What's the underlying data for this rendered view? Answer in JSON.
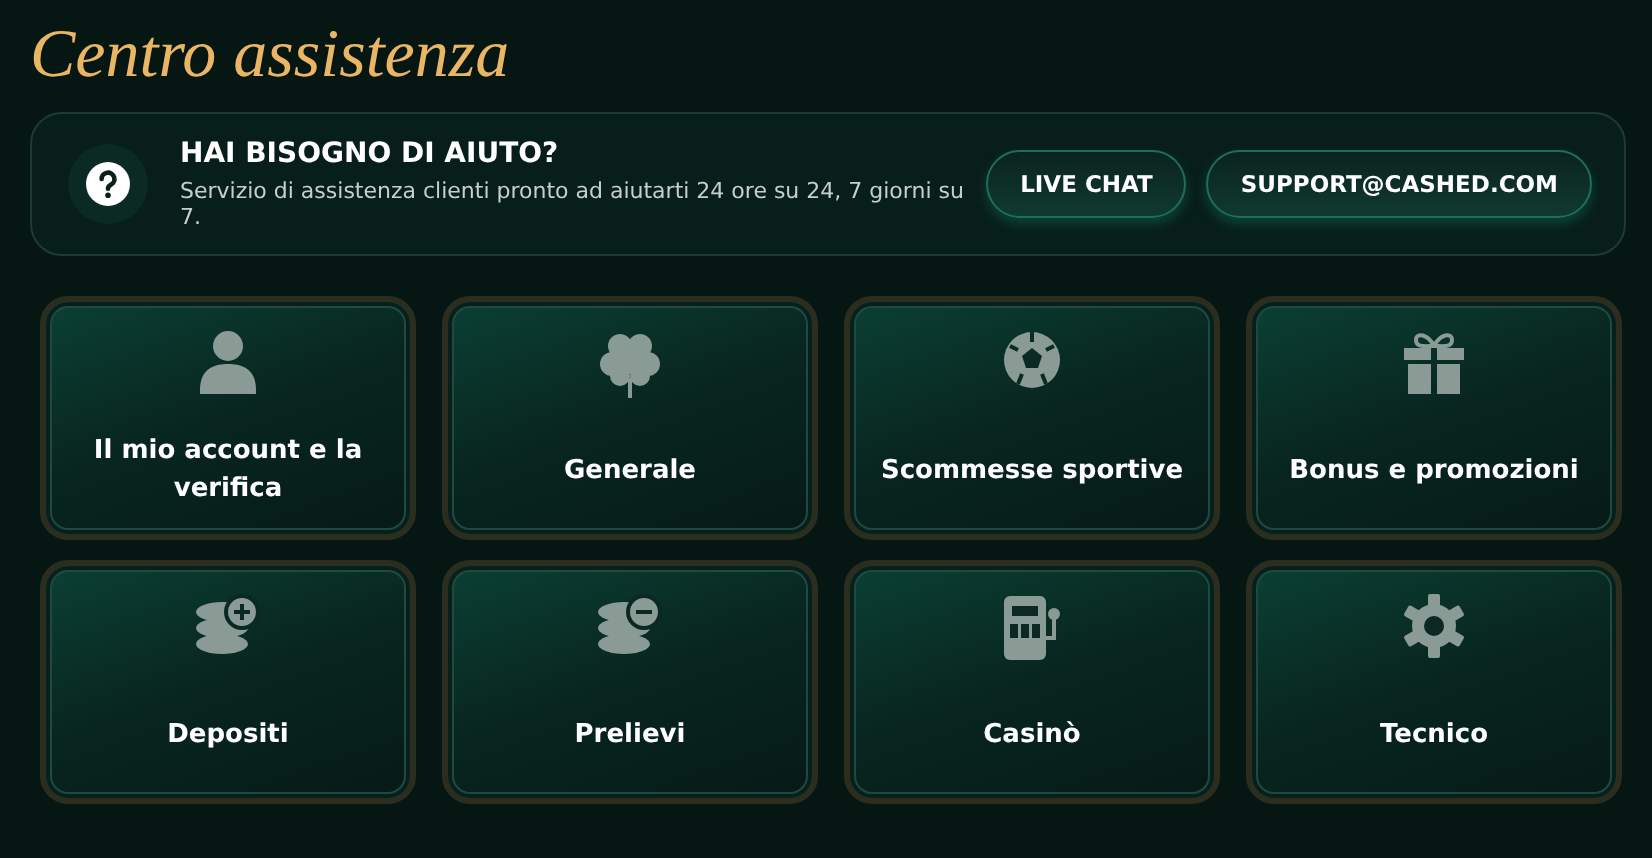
{
  "page_title": "Centro assistenza",
  "help": {
    "title": "HAI BISOGNO DI AIUTO?",
    "text": "Servizio di assistenza clienti pronto ad aiutarti 24 ore su 24, 7 giorni su 7.",
    "buttons": [
      "LIVE CHAT",
      "SUPPORT@CASHED.COM"
    ]
  },
  "categories": [
    {
      "label": "Il mio account e la verifica"
    },
    {
      "label": "Generale"
    },
    {
      "label": "Scommesse sportive"
    },
    {
      "label": "Bonus e promozioni"
    },
    {
      "label": "Depositi"
    },
    {
      "label": "Prelievi"
    },
    {
      "label": "Casinò"
    },
    {
      "label": "Tecnico"
    }
  ]
}
